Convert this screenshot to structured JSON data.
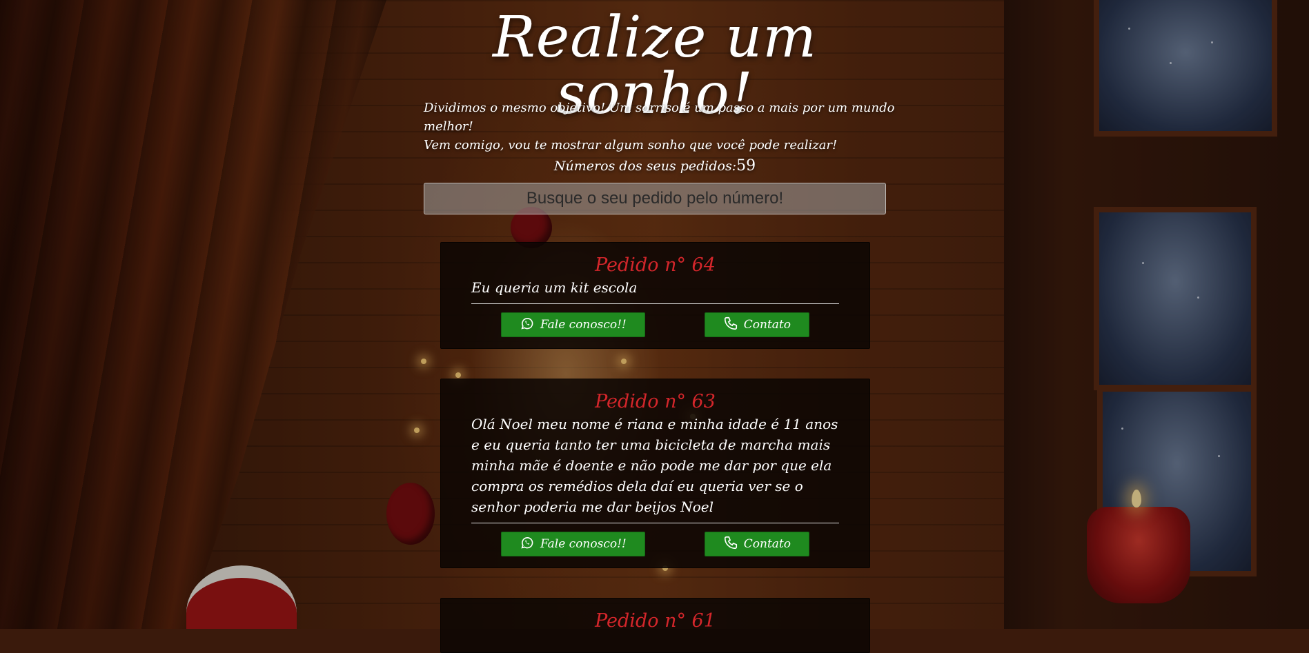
{
  "hero": {
    "title": "Realize um sonho!",
    "subtitle_line1": "Dividimos o mesmo objetivo! Um sorriso é um passo a mais por um mundo melhor!",
    "subtitle_line2": "Vem comigo, vou te mostrar algum sonho que você pode realizar!"
  },
  "orders": {
    "count_label": "Números dos seus pedidos:",
    "count_value": "59"
  },
  "search": {
    "placeholder": "Busque o seu pedido pelo número!"
  },
  "cards": [
    {
      "title": "Pedido n° 64",
      "text": "Eu queria um kit escola",
      "whatsapp_label": "Fale conosco!!",
      "contact_label": "Contato"
    },
    {
      "title": "Pedido n° 63",
      "text": "Olá Noel meu nome é riana e minha idade é 11 anos e eu queria tanto ter uma bicicleta de marcha mais minha mãe é doente e não pode me dar por que ela compra os remédios dela daí eu queria ver se o senhor poderia me dar beijos Noel",
      "whatsapp_label": "Fale conosco!!",
      "contact_label": "Contato"
    },
    {
      "title": "Pedido n° 61"
    }
  ],
  "icons": {
    "whatsapp": "whatsapp-icon",
    "phone": "phone-icon"
  },
  "colors": {
    "title_red": "#d4262b",
    "button_green": "#1f8a1f"
  }
}
